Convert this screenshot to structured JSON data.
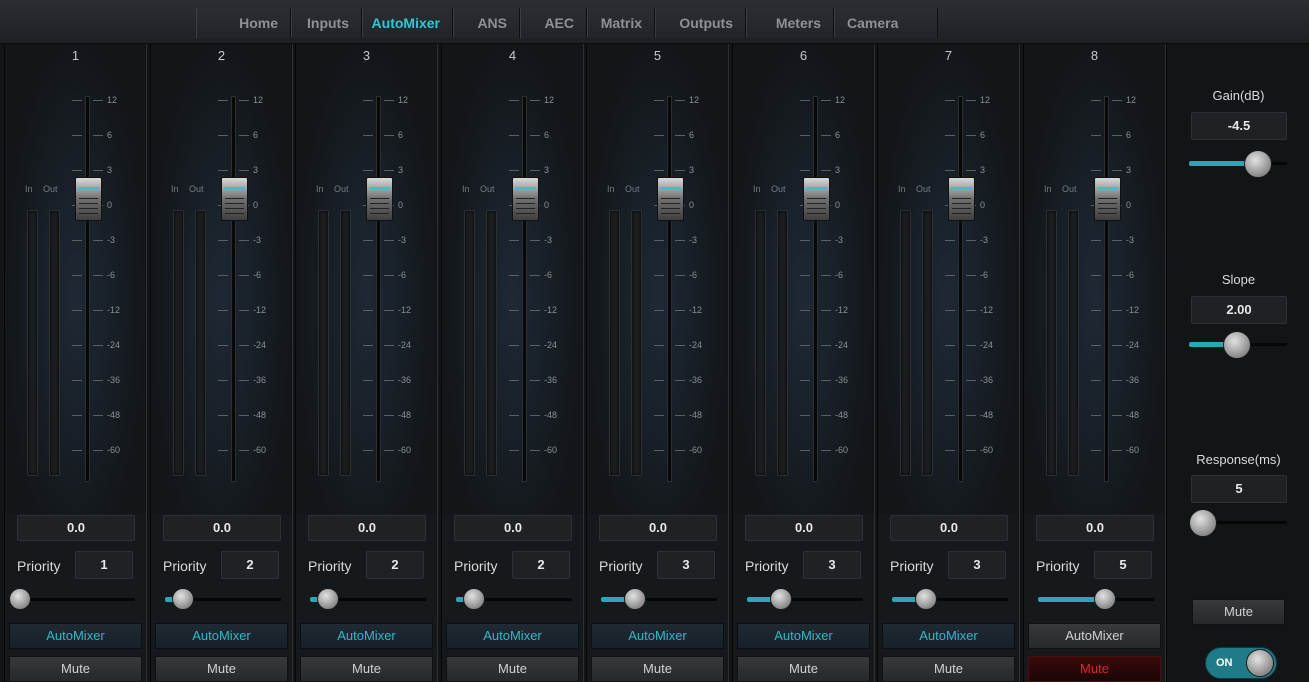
{
  "nav": {
    "tabs": [
      {
        "label": "Home"
      },
      {
        "label": "Inputs"
      },
      {
        "label": "AutoMixer",
        "active": true
      },
      {
        "label": "ANS"
      },
      {
        "label": "AEC"
      },
      {
        "label": "Matrix"
      },
      {
        "label": "Outputs"
      },
      {
        "label": "Meters"
      },
      {
        "label": "Camera"
      }
    ]
  },
  "channel_common": {
    "in_label": "In",
    "out_label": "Out",
    "scale": [
      "12",
      "6",
      "3",
      "0",
      "-3",
      "-6",
      "-12",
      "-24",
      "-36",
      "-48",
      "-60"
    ],
    "priority_label": "Priority",
    "priority_max": 8
  },
  "channels": [
    {
      "number": "1",
      "gain": "0.0",
      "priority": "1",
      "automixer_label": "AutoMixer",
      "automixer_on": true,
      "mute_label": "Mute",
      "mute_on": false
    },
    {
      "number": "2",
      "gain": "0.0",
      "priority": "2",
      "automixer_label": "AutoMixer",
      "automixer_on": true,
      "mute_label": "Mute",
      "mute_on": false
    },
    {
      "number": "3",
      "gain": "0.0",
      "priority": "2",
      "automixer_label": "AutoMixer",
      "automixer_on": true,
      "mute_label": "Mute",
      "mute_on": false
    },
    {
      "number": "4",
      "gain": "0.0",
      "priority": "2",
      "automixer_label": "AutoMixer",
      "automixer_on": true,
      "mute_label": "Mute",
      "mute_on": false
    },
    {
      "number": "5",
      "gain": "0.0",
      "priority": "3",
      "automixer_label": "AutoMixer",
      "automixer_on": true,
      "mute_label": "Mute",
      "mute_on": false
    },
    {
      "number": "6",
      "gain": "0.0",
      "priority": "3",
      "automixer_label": "AutoMixer",
      "automixer_on": true,
      "mute_label": "Mute",
      "mute_on": false
    },
    {
      "number": "7",
      "gain": "0.0",
      "priority": "3",
      "automixer_label": "AutoMixer",
      "automixer_on": true,
      "mute_label": "Mute",
      "mute_on": false
    },
    {
      "number": "8",
      "gain": "0.0",
      "priority": "5",
      "automixer_label": "AutoMixer",
      "automixer_on": false,
      "mute_label": "Mute",
      "mute_on": true
    }
  ],
  "master": {
    "gain_label": "Gain(dB)",
    "gain_value": "-4.5",
    "gain_slider_fraction": 0.78,
    "slope_label": "Slope",
    "slope_value": "2.00",
    "slope_slider_fraction": 0.48,
    "response_label": "Response(ms)",
    "response_value": "5",
    "response_slider_fraction": 0.0,
    "mute_label": "Mute",
    "toggle_label": "ON"
  },
  "colors": {
    "accent": "#2ec7d8",
    "mute_active": "#e22424",
    "background": "#121416"
  }
}
